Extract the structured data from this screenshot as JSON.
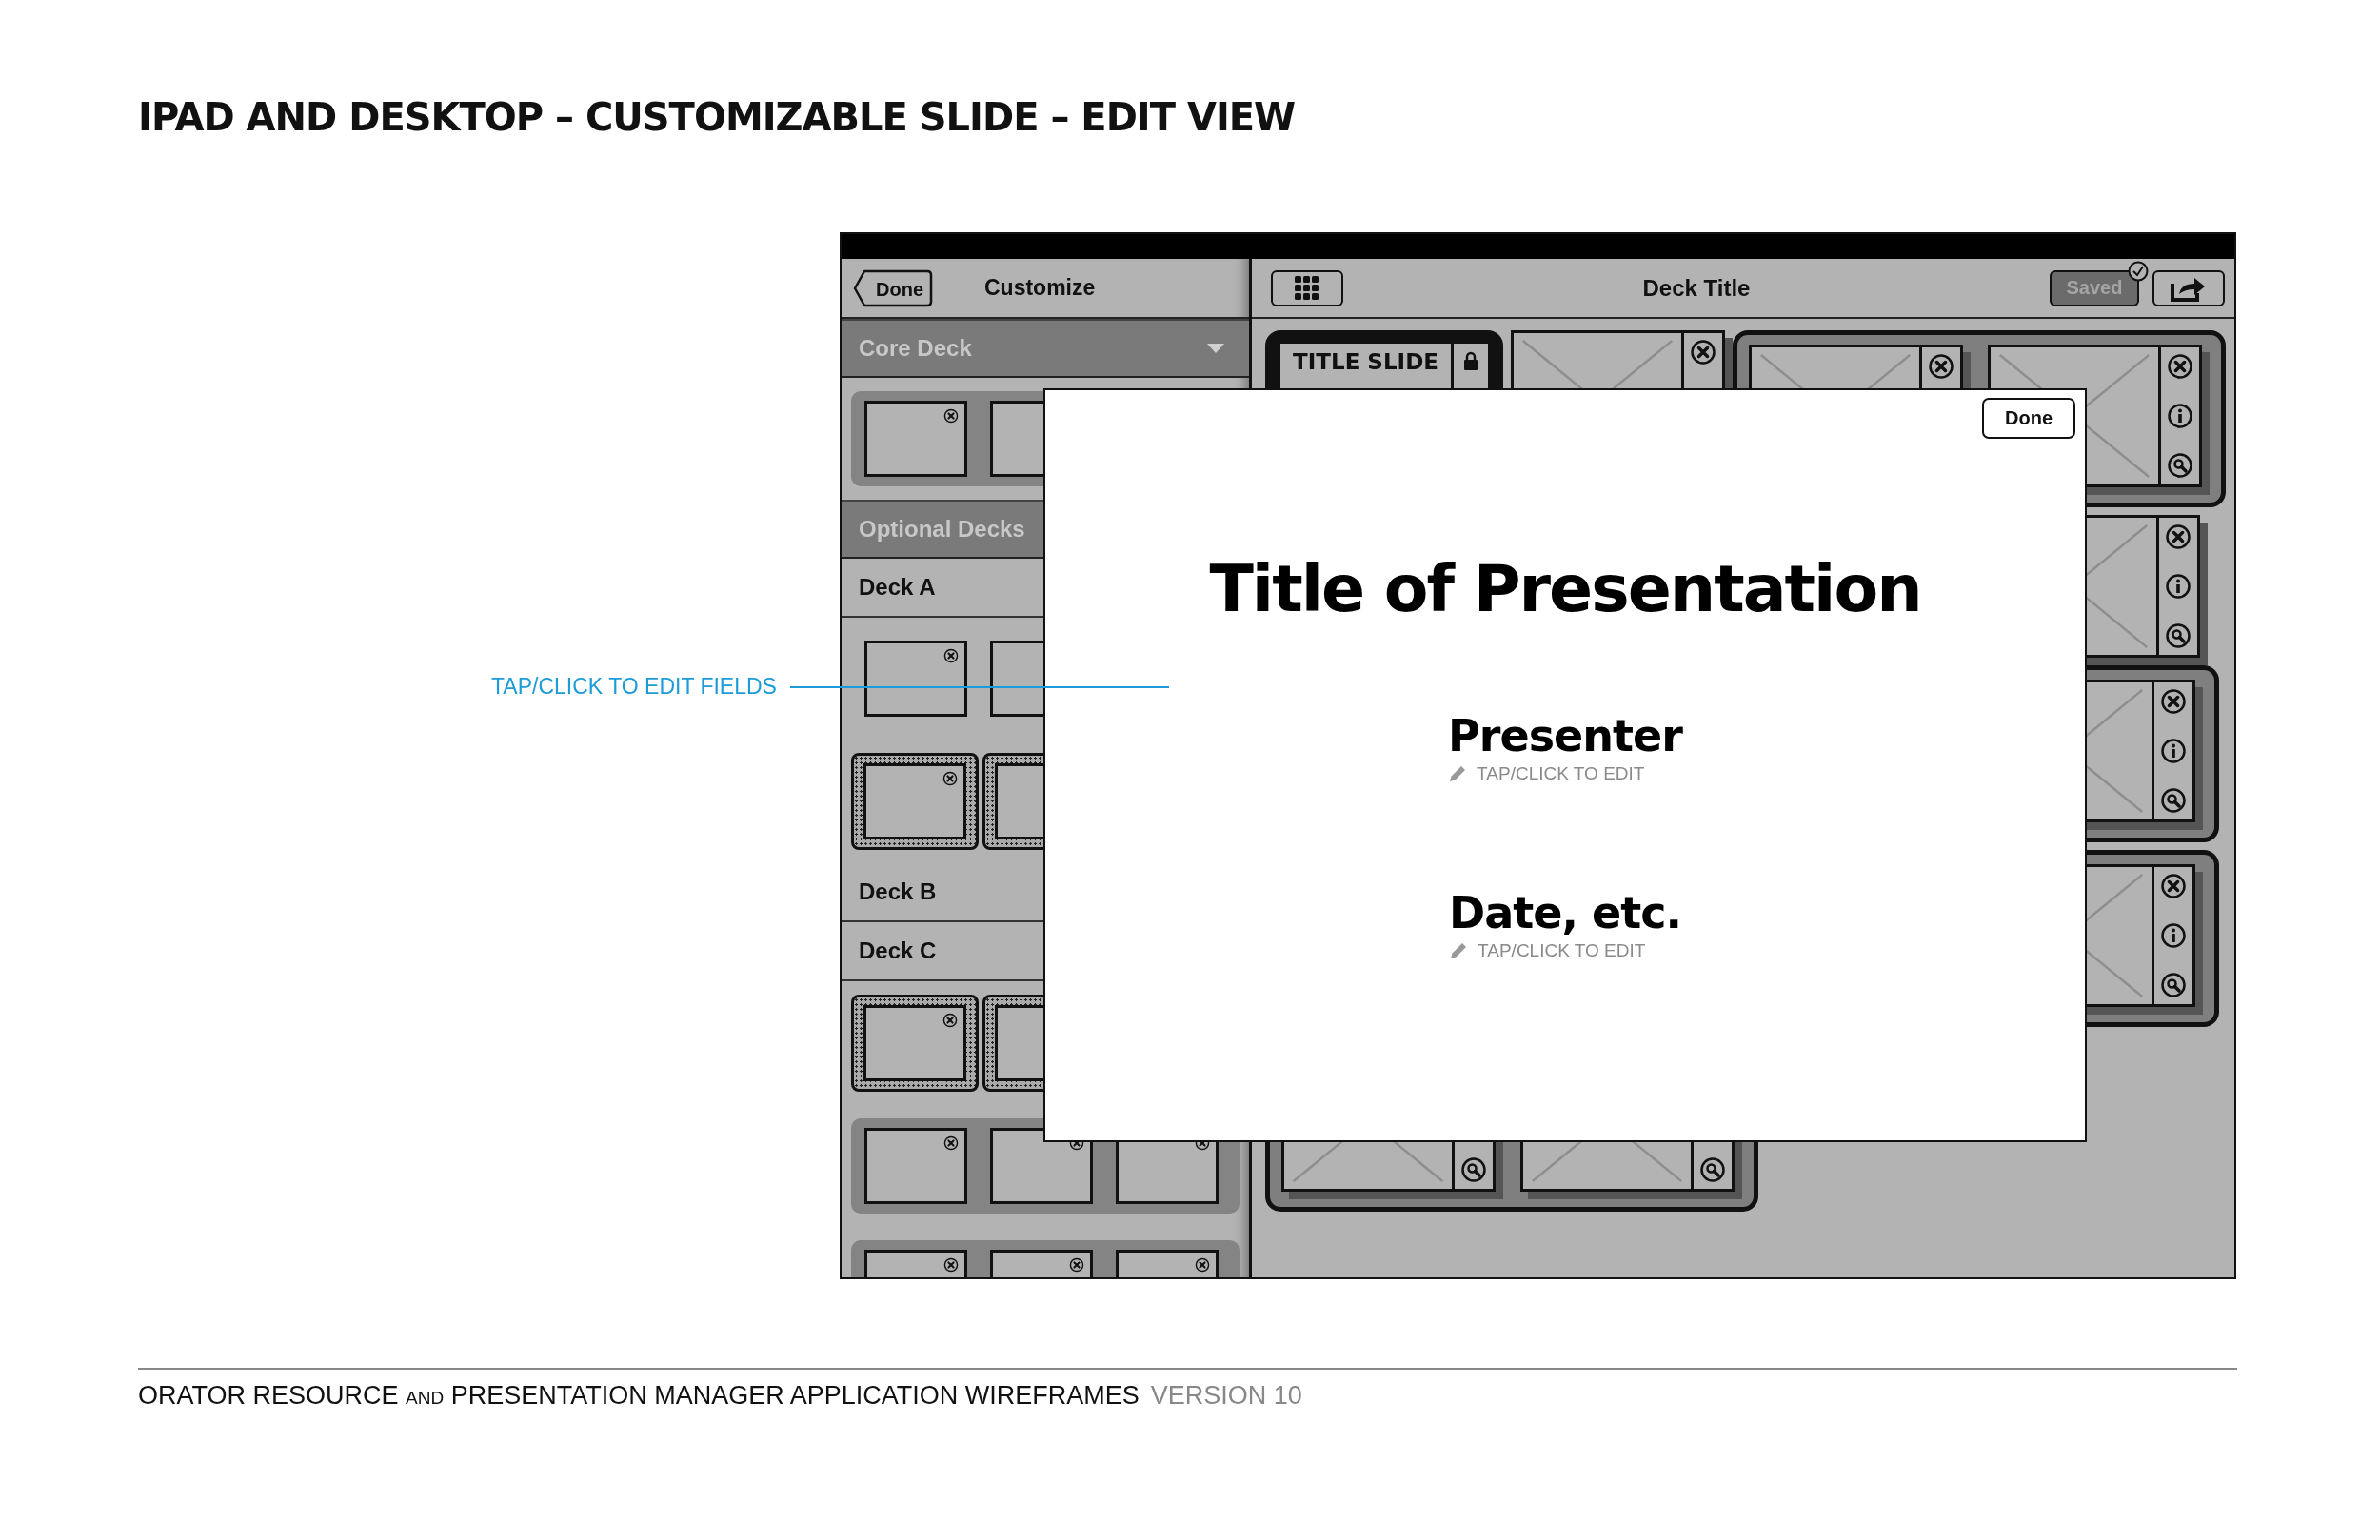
{
  "page_title": "IPAD AND DESKTOP – CUSTOMIZABLE SLIDE – EDIT VIEW",
  "annotation": "TAP/CLICK TO EDIT FIELDS",
  "sidebar": {
    "back_button": "Done",
    "title": "Customize",
    "items": [
      {
        "kind": "category",
        "label": "Core Deck",
        "dropdown": true
      },
      {
        "kind": "panel"
      },
      {
        "kind": "category",
        "label": "Optional Decks"
      },
      {
        "kind": "deck",
        "label": "Deck A"
      },
      {
        "kind": "plain"
      },
      {
        "kind": "dotted"
      },
      {
        "kind": "deck",
        "label": "Deck B"
      },
      {
        "kind": "deck",
        "label": "Deck C"
      },
      {
        "kind": "dotted"
      },
      {
        "kind": "panel"
      },
      {
        "kind": "panel"
      }
    ]
  },
  "toolbar": {
    "title": "Deck Title",
    "saved_button": {
      "label": "Saved",
      "disabled": true
    }
  },
  "title_slide": {
    "label": "TITLE SLIDE",
    "locked": true
  },
  "modal": {
    "done_button": "Done",
    "title": "Title of Presentation",
    "fields": [
      {
        "value": "Presenter",
        "hint": "TAP/CLICK TO EDIT"
      },
      {
        "value": "Date, etc.",
        "hint": "TAP/CLICK TO EDIT"
      }
    ]
  },
  "footer": {
    "parts": [
      {
        "kind": "normal",
        "text": "ORATOR RESOURCE"
      },
      {
        "kind": "small",
        "text": "AND"
      },
      {
        "kind": "normal",
        "text": "PRESENTATION MANAGER APPLICATION WIREFRAMES"
      }
    ],
    "version": "VERSION 10"
  }
}
